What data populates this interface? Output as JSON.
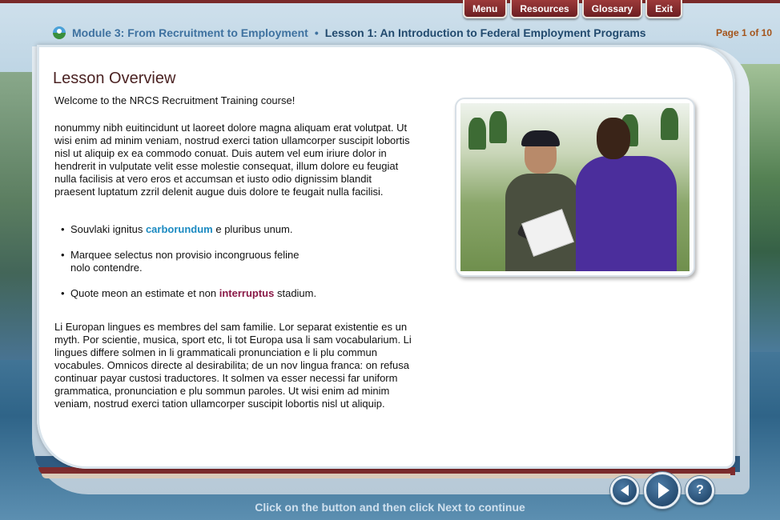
{
  "top_menu": {
    "items": [
      "Menu",
      "Resources",
      "Glossary",
      "Exit"
    ]
  },
  "header": {
    "module_title": "Module 3: From Recruitment to Employment",
    "separator": "•",
    "lesson_title": "Lesson 1: An Introduction to Federal Employment Programs",
    "page_indicator": "Page 1 of 10"
  },
  "lesson": {
    "heading": "Lesson Overview",
    "welcome": "Welcome to the NRCS Recruitment Training course!",
    "paragraph1": "nonummy nibh euitincidunt ut laoreet dolore magna aliquam erat volutpat. Ut wisi enim ad minim veniam, nostrud exerci tation ullamcorper suscipit lobortis nisl ut aliquip ex ea commodo conuat. Duis autem vel eum iriure dolor in hendrerit in vulputate velit esse molestie consequat, illum dolore eu feugiat nulla facilisis at vero eros et accumsan et iusto odio dignissim blandit praesent luptatum zzril delenit augue duis dolore te feugait nulla facilisi.",
    "bullets": [
      {
        "before": "Souvlaki ignitus ",
        "keyword": "carborundum",
        "after": " e pluribus unum."
      },
      {
        "before": "Marquee selectus non provisio incongruous feline nolo contendre.",
        "keyword": "",
        "after": ""
      },
      {
        "before": "Quote meon an estimate et non ",
        "keyword": "interruptus",
        "after": " stadium."
      }
    ],
    "paragraph2": "Li Europan lingues es membres del sam familie. Lor separat existentie es un myth. Por scientie, musica, sport etc, li tot Europa usa li sam vocabularium. Li lingues differe solmen in li grammaticali pronunciation e li plu commun vocabules. Omnicos directe al desirabilita; de un nov lingua franca: on refusa continuar payar custosi traductores. It solmen va esser necessi far uniform grammatica, pronunciation e plu sommun paroles. Ut wisi enim ad minim veniam, nostrud exerci tation ullamcorper suscipit lobortis nisl ut aliquip."
  },
  "footer": {
    "instruction": "Click on the button and then click Next to continue",
    "help_label": "?"
  },
  "colors": {
    "tab_red": "#7a2a2a",
    "module_blue": "#3f72a0",
    "keyword_blue": "#1b8ac1",
    "keyword_red": "#8a1a47",
    "page_orange": "#a4541b"
  }
}
